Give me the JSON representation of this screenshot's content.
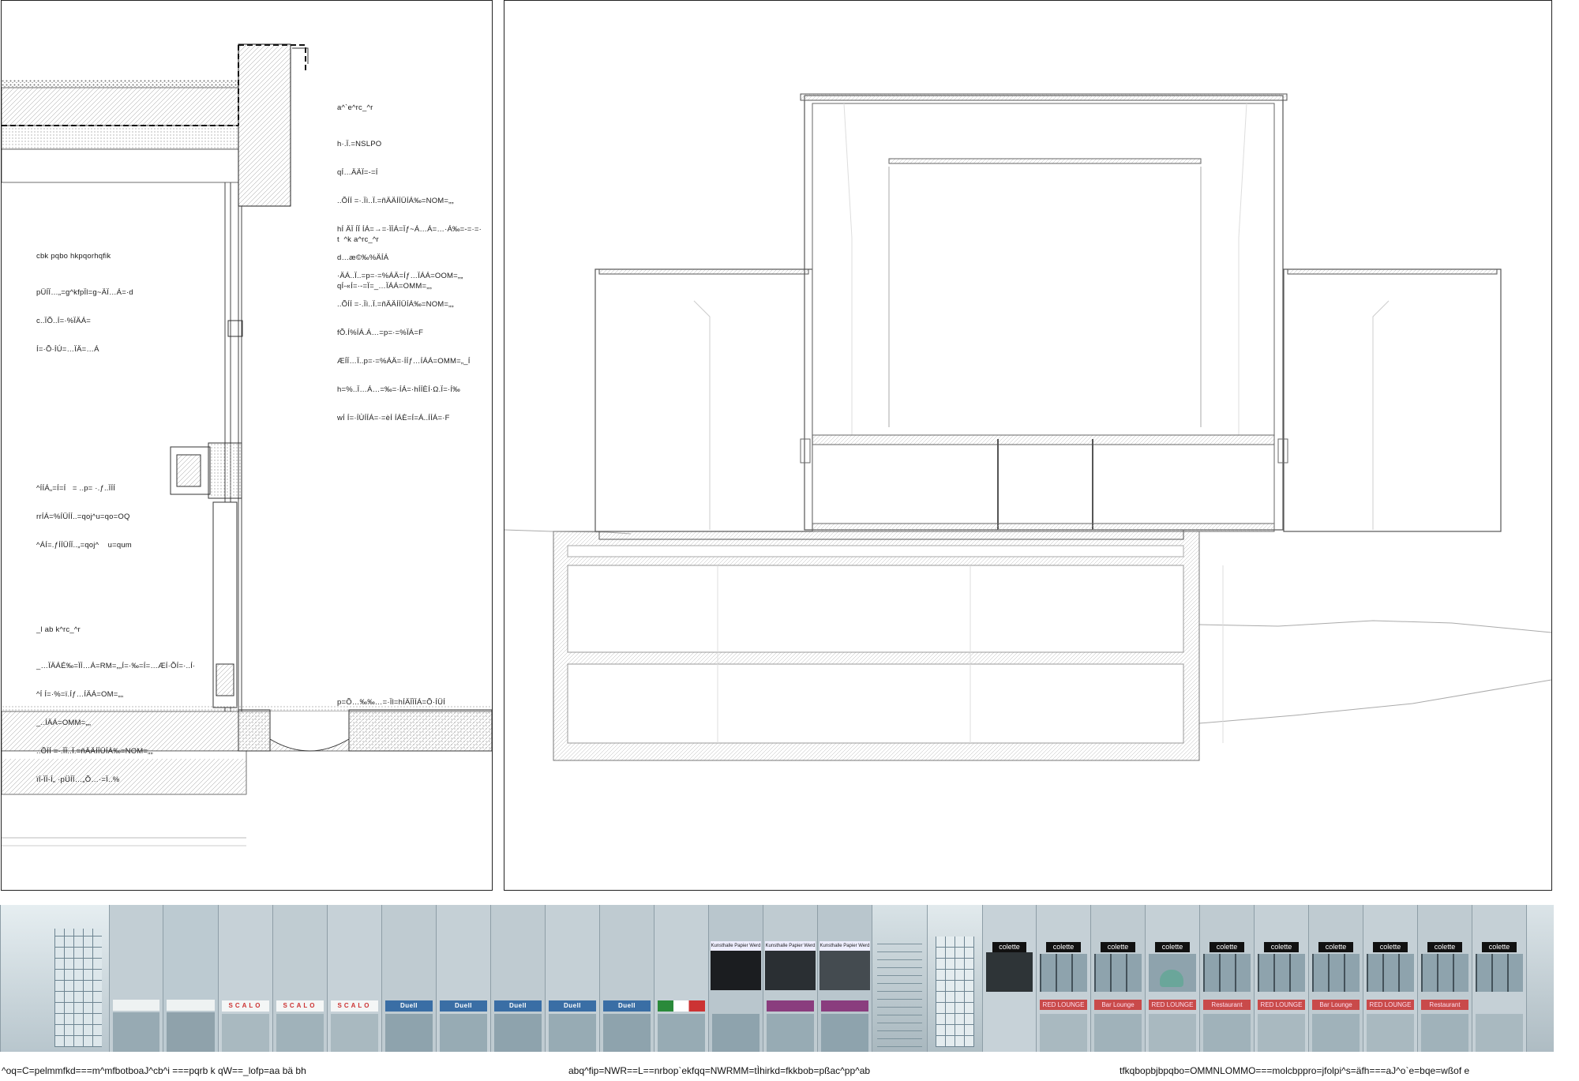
{
  "detail_notes": {
    "roof": {
      "title": "a^`e^rc_^r",
      "lines": [
        "h·.Ï.=NSLPO",
        "qÍ…ÄÄÏ=‑=Í",
        "..ÕÍÍ =·.Ïì..Ï.=ñÄÄÍÍÜÍÁ‰=NOM=„„",
        "hÍ ÄÏ ÍÏ ÍÁ=→=·ÏÍÁ=Ïƒ~Á…Á=…·Á‰=‑=·=·",
        "d…æ©‰%ÄÍÁ",
        "qÍ‑«Í=·‑=Ï=_…ÏÁÁ=OMM=„„"
      ]
    },
    "insulation": {
      "title": "cbk pqbo hkpqorhqfik",
      "lines": [
        "pÜÍÏ…„=g^kfpÏl=g~ÄÏ…Á=·d",
        "c..ÏÕ..Í=·%ÏÄÁ=",
        "Í=·Õ·ÍÚ=…ÏÄ=…Á"
      ]
    },
    "wall": {
      "title": "t  ^k a^rc_^r",
      "lines": [
        "·ÄÁ..Ï..=p=·=%ÁÄ=Íƒ…ÏÁÁ=OOM=„„",
        "..ÕÍÍ =·.Ïì..Ï.=ñÄÄÍÍÜÍÁ‰=NOM=„„",
        "fÕ.Í%ÍÁ.Á…=p=·=%ÏÁ=F",
        "ÆÍÏ…Ï..p=·=%ÁÄ=·ÍÍƒ…ÍÁÁ=OMM=„_Í",
        "h=%..Ï…Á…=‰=·ÍÁ=·hÍÍÈÍ·Ω.Ï=·Í‰",
        "wÍ Í=·ÍÙÍÍÁ=·=èÍ ÍÁÈ=Í=Á..ÍÍÁ=·F"
      ]
    },
    "window": {
      "title": "",
      "lines": [
        "^ÍÍÁ„=Í=Í   = ..p= ·.ƒ..ÏÍÍ",
        "rrÍÁ=%ÍÜÍÍ..=qoj^u=qo=OQ",
        "^ÁÍ=.ƒÍÍÜÍÏ..„=qoj^    u=qum"
      ]
    },
    "floor": {
      "title": "_l ab k^rc_^r",
      "lines": [
        "_…ÏÄÁÉ‰=ÏÍ…Á=RM=„„Í=·‰=Í=…ÆÍ·ÕÍ=·..Í·",
        "^Í Í=·%=ï.Íƒ…ÍÄÁ=OM=„„",
        "_..ÍÄÁ=OMM=„„",
        "..ÕÍÍ =·.ÏÏ..Ï.=ñÄÄÍÍÜÍÁ‰=NOM=„„",
        "ïÍ‑ÏÍ‑Í„ ·pÜÍÏ…„Õ…·=Ï..%"
      ]
    },
    "bottom_right": {
      "title": "",
      "lines": [
        "p=Õ…‰‰…=·Ïl=hÍÄÏÏÍÁ=Õ·ÍÜÍ"
      ]
    }
  },
  "facade": {
    "signs": {
      "scalo": "SCALO",
      "duell": "Duell",
      "kunsthalle": "Kunsthalle Papier Werd",
      "colette": "colette",
      "red_lounge": "RED LOUNGE",
      "bar_lounge": "Bar Lounge",
      "restaurant": "Restaurant"
    }
  },
  "captions": {
    "left": "^oq=C=pelmmfkd===m^mfbotboaJ^cb^i ===pqrb k qW==_lofp=aa bä bh",
    "center": "abq^fip=NWR==L==nrbop`ekfqq=NWRMM=tÌhirkd=fkkbob=pßac^pp^ab",
    "right": "tfkqbopbjbpqbo=OMMNLOMMO===molcbppro=jfolpi^s=äfh===aJ^o`e=bqe=wßof  e"
  }
}
